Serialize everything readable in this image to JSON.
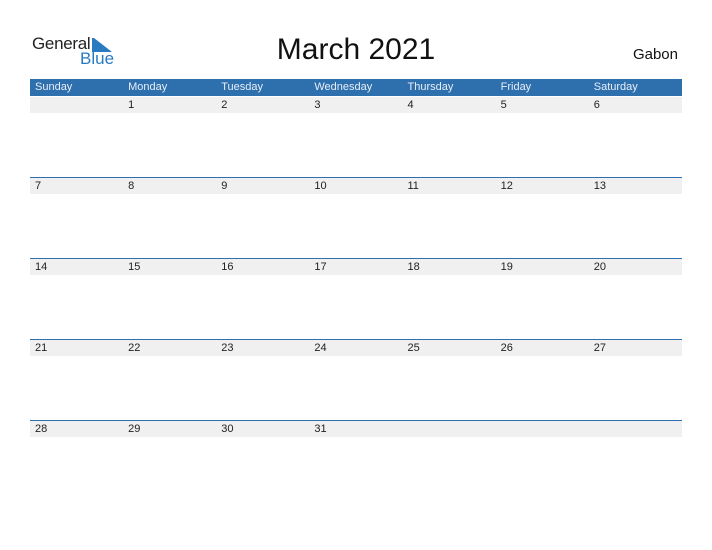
{
  "logo": {
    "word1": "General",
    "word2": "Blue",
    "accent": "#2a7ac0"
  },
  "title": "March 2021",
  "country": "Gabon",
  "colors": {
    "header_bg": "#2e6fae",
    "date_strip_bg": "#f0f0f0"
  },
  "weekdays": [
    "Sunday",
    "Monday",
    "Tuesday",
    "Wednesday",
    "Thursday",
    "Friday",
    "Saturday"
  ],
  "weeks": [
    [
      "",
      "1",
      "2",
      "3",
      "4",
      "5",
      "6"
    ],
    [
      "7",
      "8",
      "9",
      "10",
      "11",
      "12",
      "13"
    ],
    [
      "14",
      "15",
      "16",
      "17",
      "18",
      "19",
      "20"
    ],
    [
      "21",
      "22",
      "23",
      "24",
      "25",
      "26",
      "27"
    ],
    [
      "28",
      "29",
      "30",
      "31",
      "",
      "",
      ""
    ]
  ]
}
